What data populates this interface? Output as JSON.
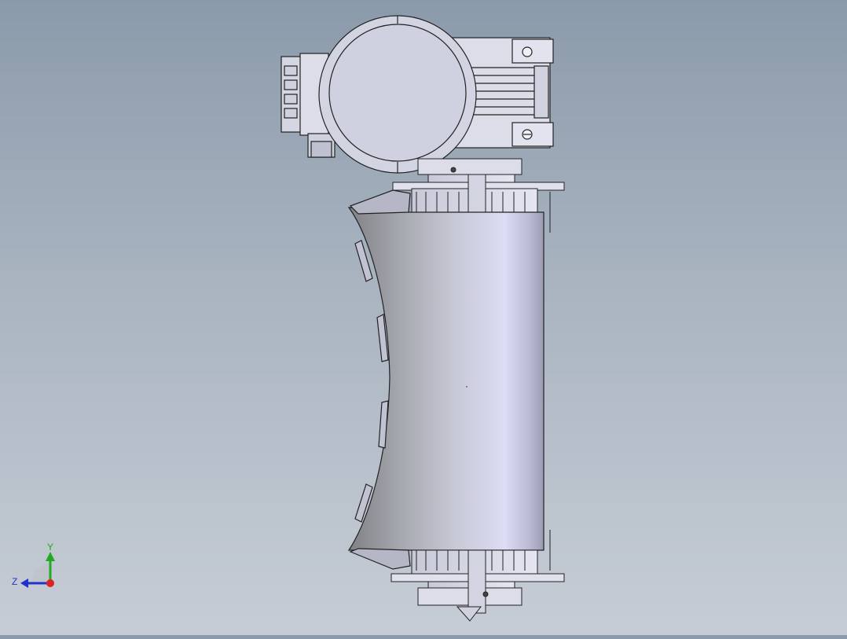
{
  "viewport": {
    "background_top": "#8b9aab",
    "background_bottom": "#c7cdd6"
  },
  "model": {
    "description_icon": "roller-with-gearmotor-model",
    "body_color": "#c9cbde",
    "edge_color": "#222222"
  },
  "triad": {
    "icon": "view-orientation-triad-icon",
    "y_label": "Y",
    "z_label": "Z",
    "y_color": "#22aa22",
    "z_color": "#2233cc",
    "x_color": "#dd2222"
  }
}
